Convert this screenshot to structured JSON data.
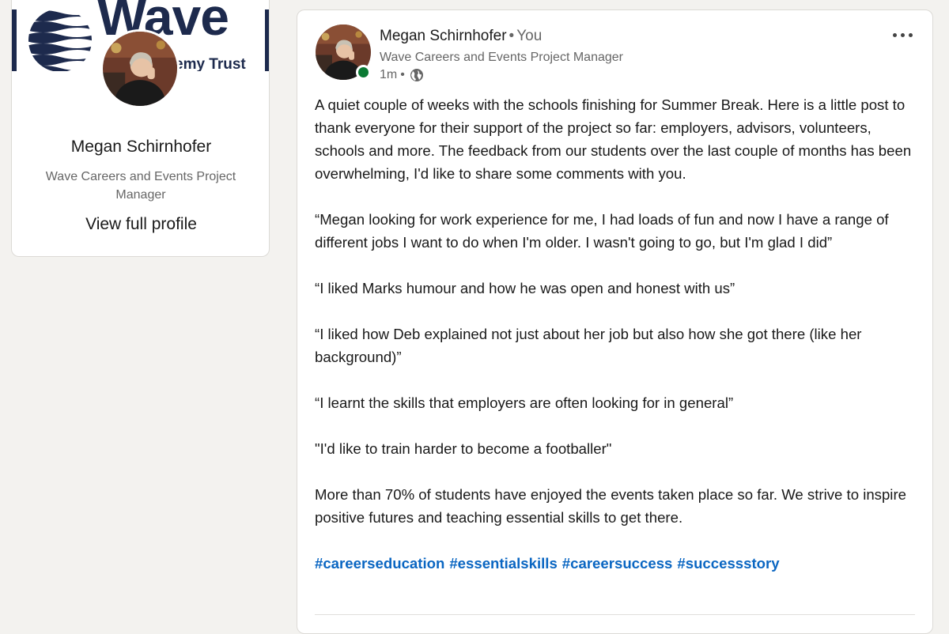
{
  "profile": {
    "banner_word": "Wave",
    "banner_trust": "emy Trust",
    "name": "Megan Schirnhofer",
    "headline": "Wave Careers and Events Project Manager",
    "view_profile_label": "View full profile"
  },
  "post": {
    "author_name": "Megan Schirnhofer",
    "relation": "You",
    "author_headline": "Wave Careers and Events Project Manager",
    "time": "1m",
    "paragraphs": [
      "A quiet couple of weeks with the schools finishing for Summer Break. Here is a little post to thank everyone for their support of the project so far: employers, advisors, volunteers, schools and more. The feedback from our students over the last couple of months has been overwhelming, I'd like to share some comments with you.",
      "“Megan looking for work experience for me, I had loads of fun and now I have a range of different jobs I want to do when I'm older. I wasn't going to go, but I'm glad I did”",
      "“I liked Marks humour and how he was open and honest with us”",
      "“I liked how Deb explained not just about her job but also how she got there (like her background)”",
      "“I learnt the skills that employers are often looking for in general”",
      "\"I'd like to train harder to become a footballer\"",
      "More than 70% of students have enjoyed the events taken place so far. We strive to inspire positive futures and teaching essential skills to get there."
    ],
    "hashtags": [
      "#careerseducation",
      "#essentialskills",
      "#careersuccess",
      "#successstory"
    ]
  },
  "colors": {
    "link": "#0a66c2",
    "online": "#0b7a34",
    "brand_navy": "#1d2a4d"
  },
  "icons": {
    "more": "more-options-icon",
    "visibility": "globe-icon",
    "status": "online-status-icon"
  }
}
